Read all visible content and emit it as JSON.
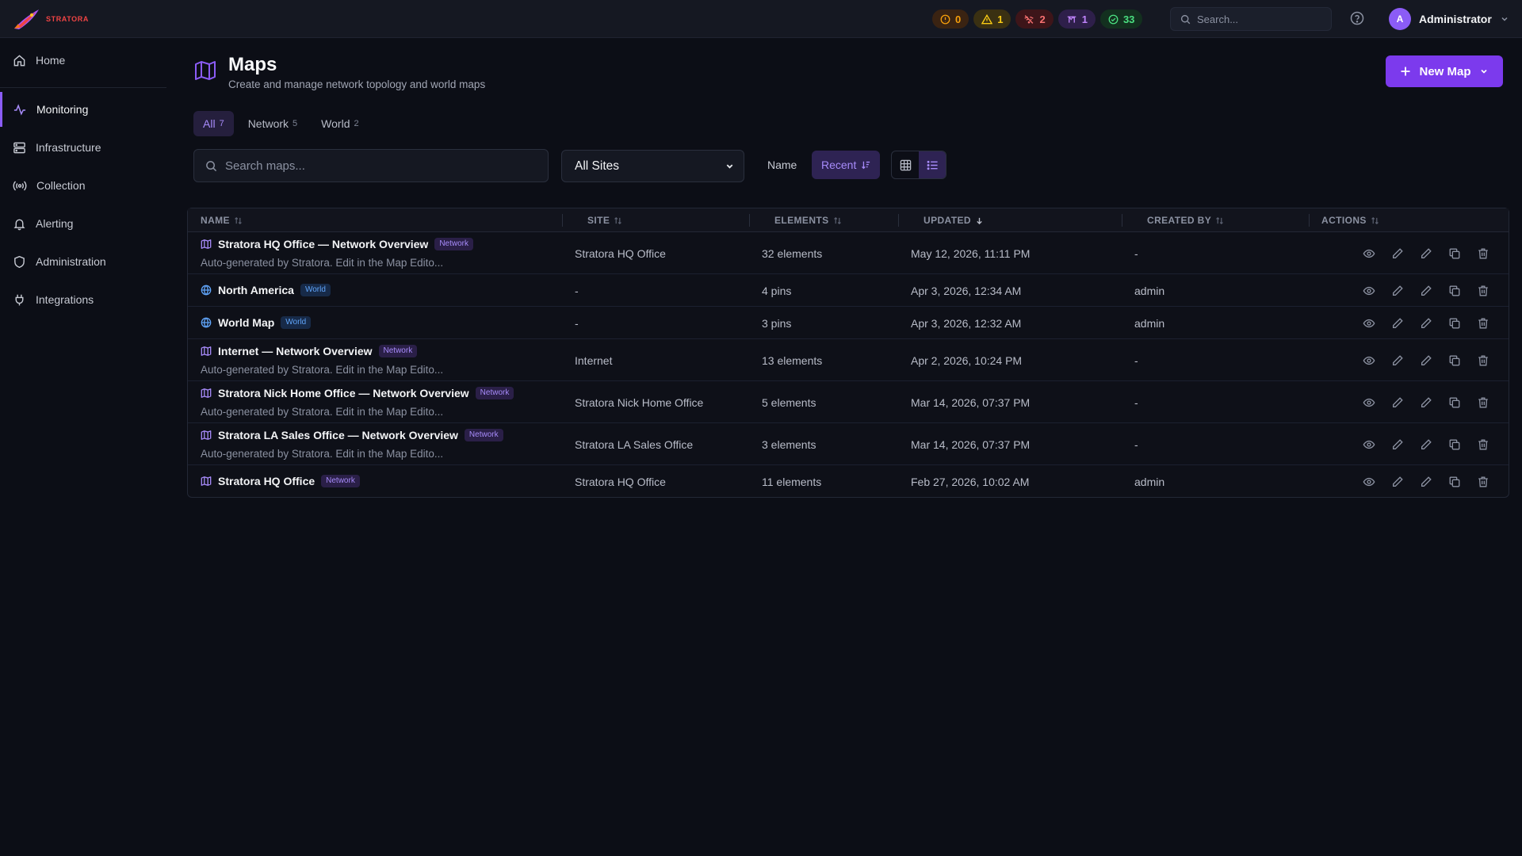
{
  "app": {
    "brand_name": "STRATORA"
  },
  "topbar": {
    "status_pills": [
      {
        "name": "status-critical",
        "count": "0",
        "color": "#f59e0b",
        "icon": "alert-circle-icon"
      },
      {
        "name": "status-warning",
        "count": "1",
        "color": "#facc15",
        "icon": "warning-triangle-icon"
      },
      {
        "name": "status-down",
        "count": "2",
        "color": "#f87171",
        "icon": "wifi-off-icon"
      },
      {
        "name": "status-maintenance",
        "count": "1",
        "color": "#c084fc",
        "icon": "flag-icon"
      },
      {
        "name": "status-ok",
        "count": "33",
        "color": "#4ade80",
        "icon": "check-circle-icon"
      }
    ],
    "search_placeholder": "Search...",
    "user": {
      "initial": "A",
      "name": "Administrator"
    }
  },
  "sidebar": {
    "items": [
      {
        "label": "Home",
        "icon": "home-icon"
      },
      {
        "label": "Monitoring",
        "icon": "activity-icon",
        "active": true
      },
      {
        "label": "Infrastructure",
        "icon": "server-icon"
      },
      {
        "label": "Collection",
        "icon": "radio-icon"
      },
      {
        "label": "Alerting",
        "icon": "bell-icon"
      },
      {
        "label": "Administration",
        "icon": "shield-icon"
      },
      {
        "label": "Integrations",
        "icon": "plug-icon"
      }
    ]
  },
  "header": {
    "title": "Maps",
    "subtitle": "Create and manage network topology and world maps",
    "new_button": "New Map"
  },
  "tabs": [
    {
      "label": "All",
      "count": "7",
      "active": true
    },
    {
      "label": "Network",
      "count": "5"
    },
    {
      "label": "World",
      "count": "2"
    }
  ],
  "filters": {
    "search_placeholder": "Search maps...",
    "site_selected": "All Sites",
    "sort_name": "Name",
    "sort_recent": "Recent"
  },
  "table": {
    "columns": [
      "NAME",
      "SITE",
      "ELEMENTS",
      "UPDATED",
      "CREATED BY",
      "ACTIONS"
    ],
    "rows": [
      {
        "name": "Stratora HQ Office — Network Overview",
        "type": "Network",
        "desc": "Auto-generated by Stratora. Edit in the Map Edito...",
        "site": "Stratora HQ Office",
        "elements": "32 elements",
        "updated": "May 12, 2026, 11:11 PM",
        "created_by": "-"
      },
      {
        "name": "North America",
        "type": "World",
        "desc": "",
        "site": "-",
        "elements": "4 pins",
        "updated": "Apr 3, 2026, 12:34 AM",
        "created_by": "admin"
      },
      {
        "name": "World Map",
        "type": "World",
        "desc": "",
        "site": "-",
        "elements": "3 pins",
        "updated": "Apr 3, 2026, 12:32 AM",
        "created_by": "admin"
      },
      {
        "name": "Internet — Network Overview",
        "type": "Network",
        "desc": "Auto-generated by Stratora. Edit in the Map Edito...",
        "site": "Internet",
        "elements": "13 elements",
        "updated": "Apr 2, 2026, 10:24 PM",
        "created_by": "-"
      },
      {
        "name": "Stratora Nick Home Office — Network Overview",
        "type": "Network",
        "desc": "Auto-generated by Stratora. Edit in the Map Edito...",
        "site": "Stratora Nick Home Office",
        "elements": "5 elements",
        "updated": "Mar 14, 2026, 07:37 PM",
        "created_by": "-"
      },
      {
        "name": "Stratora LA Sales Office — Network Overview",
        "type": "Network",
        "desc": "Auto-generated by Stratora. Edit in the Map Edito...",
        "site": "Stratora LA Sales Office",
        "elements": "3 elements",
        "updated": "Mar 14, 2026, 07:37 PM",
        "created_by": "-"
      },
      {
        "name": "Stratora HQ Office",
        "type": "Network",
        "desc": "",
        "site": "Stratora HQ Office",
        "elements": "11 elements",
        "updated": "Feb 27, 2026, 10:02 AM",
        "created_by": "admin"
      }
    ]
  }
}
